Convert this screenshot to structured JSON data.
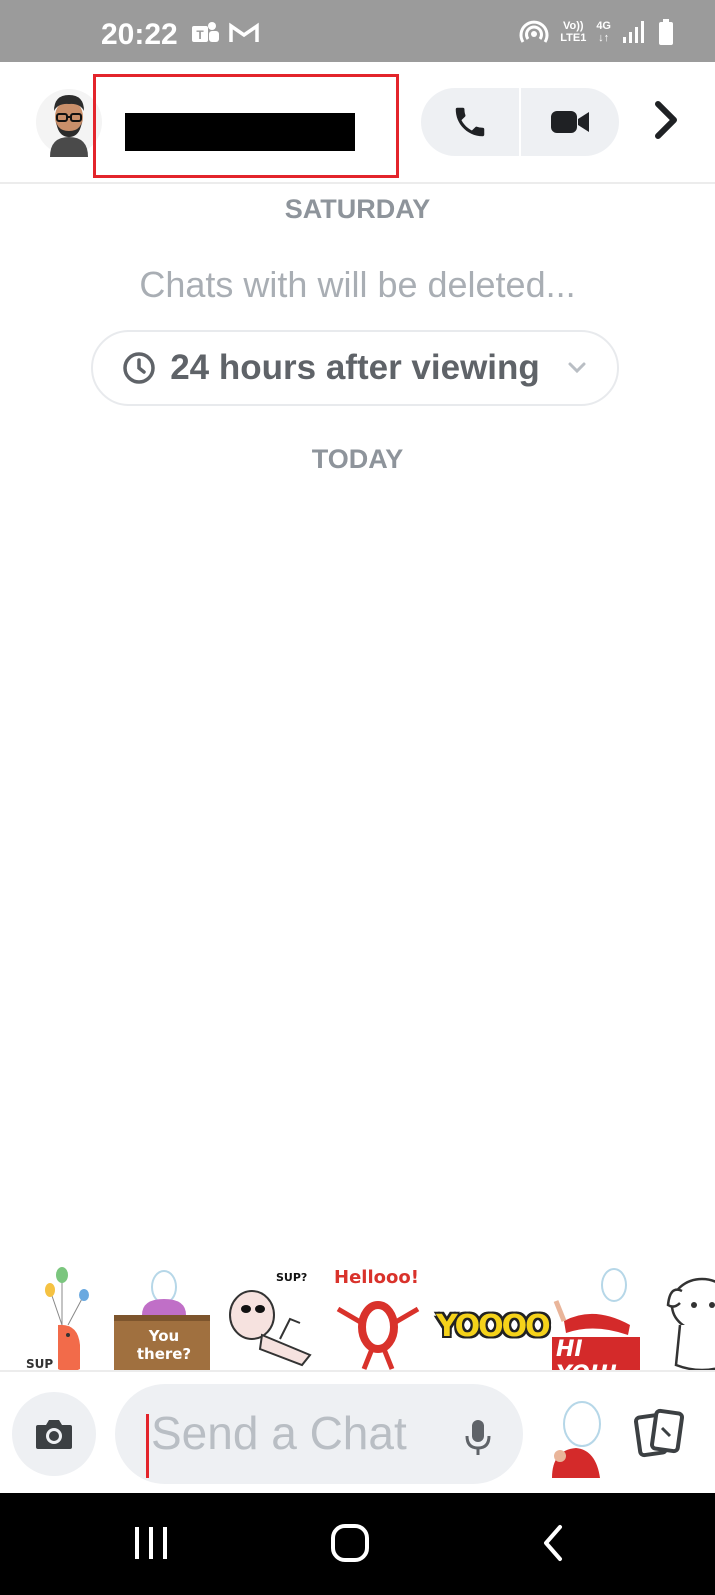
{
  "status_bar": {
    "time": "20:22",
    "left_icons": [
      "teams-icon",
      "gmail-icon"
    ],
    "network": {
      "volte": "Vo))",
      "lte": "LTE1",
      "gen": "4G"
    },
    "right_icons": [
      "hotspot-icon",
      "signal-icon",
      "battery-icon"
    ]
  },
  "header": {
    "contact_name": "",
    "name_redacted": true,
    "highlight_color": "#e3242b",
    "actions": [
      "phone-icon",
      "video-camera-icon",
      "chevron-right-icon"
    ]
  },
  "chat": {
    "day_saturday": "SATURDAY",
    "delete_note": "Chats with  will be deleted...",
    "timer_option": "24 hours after viewing",
    "day_today": "TODAY"
  },
  "stickers": [
    {
      "name": "sticker-sup-cat",
      "text": "SUP"
    },
    {
      "name": "sticker-you-there",
      "text": "You there?"
    },
    {
      "name": "sticker-sup-lounging",
      "text": "SUP?"
    },
    {
      "name": "sticker-hellooo",
      "text": "Hellooo!"
    },
    {
      "name": "sticker-yoooo",
      "text": "YOOOO"
    },
    {
      "name": "sticker-hi-you",
      "text": "HI YOU!"
    },
    {
      "name": "sticker-dog",
      "text": ""
    }
  ],
  "input": {
    "placeholder": "Send a Chat",
    "icons": [
      "camera-icon",
      "mic-icon",
      "bitmoji-icon",
      "cards-icon"
    ]
  },
  "nav": [
    "recents-icon",
    "home-icon",
    "back-icon"
  ]
}
